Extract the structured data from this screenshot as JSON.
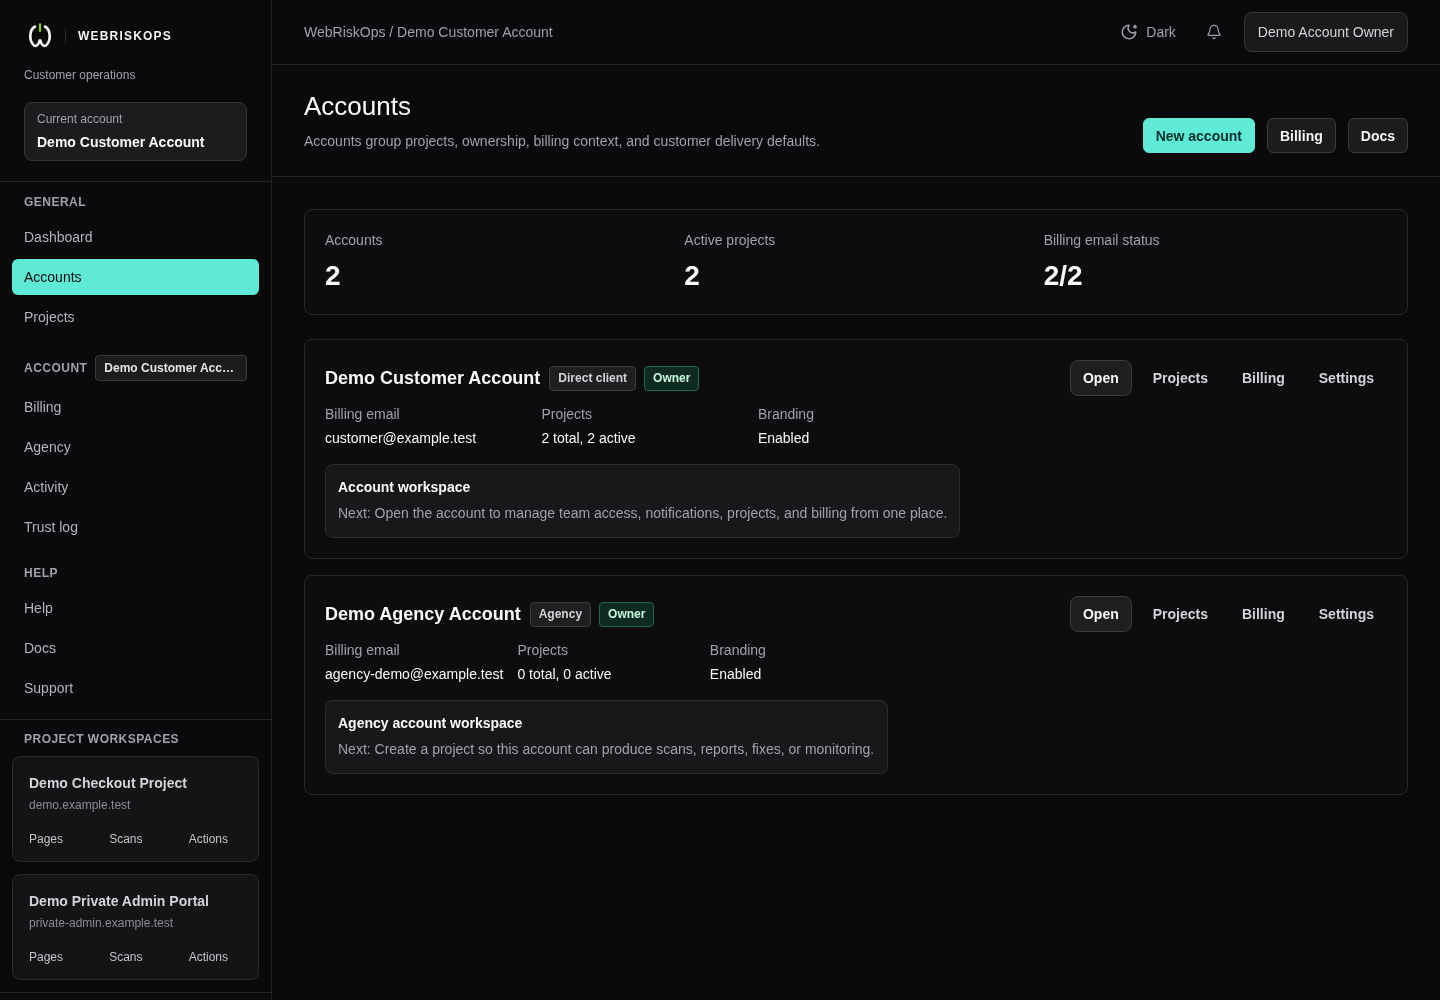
{
  "sidebar": {
    "brand": {
      "name": "WEBRISKOPS",
      "tagline": "Customer operations"
    },
    "current_account": {
      "label": "Current account",
      "name": "Demo Customer Account"
    },
    "sections": [
      {
        "title": "GENERAL",
        "items": [
          {
            "label": "Dashboard",
            "selected": false
          },
          {
            "label": "Accounts",
            "selected": true
          },
          {
            "label": "Projects",
            "selected": false
          }
        ]
      },
      {
        "title": "ACCOUNT",
        "chip": "Demo Customer Acc…",
        "items": [
          {
            "label": "Billing",
            "selected": false
          },
          {
            "label": "Agency",
            "selected": false
          },
          {
            "label": "Activity",
            "selected": false
          },
          {
            "label": "Trust log",
            "selected": false
          }
        ]
      },
      {
        "title": "HELP",
        "items": [
          {
            "label": "Help",
            "selected": false
          },
          {
            "label": "Docs",
            "selected": false
          },
          {
            "label": "Support",
            "selected": false
          }
        ]
      }
    ],
    "workspaces": {
      "title": "PROJECT WORKSPACES",
      "projects": [
        {
          "name": "Demo Checkout Project",
          "domain": "demo.example.test",
          "links": [
            "Pages",
            "Scans",
            "Actions"
          ]
        },
        {
          "name": "Demo Private Admin Portal",
          "domain": "private-admin.example.test",
          "links": [
            "Pages",
            "Scans",
            "Actions"
          ]
        }
      ]
    }
  },
  "topbar": {
    "breadcrumb": "WebRiskOps / Demo Customer Account",
    "theme": "Dark",
    "user_button": "Demo Account Owner"
  },
  "page_header": {
    "title": "Accounts",
    "subtitle": "Accounts group projects, ownership, billing context, and customer delivery defaults.",
    "actions": [
      {
        "label": "New account",
        "kind": "primary"
      },
      {
        "label": "Billing",
        "kind": "secondary"
      },
      {
        "label": "Docs",
        "kind": "secondary"
      }
    ]
  },
  "stats": [
    {
      "label": "Accounts",
      "value": "2"
    },
    {
      "label": "Active projects",
      "value": "2"
    },
    {
      "label": "Billing email status",
      "value": "2/2"
    }
  ],
  "accounts": [
    {
      "name": "Demo Customer Account",
      "badges": [
        {
          "label": "Direct client",
          "kind": "neutral"
        },
        {
          "label": "Owner",
          "kind": "success"
        }
      ],
      "actions": [
        {
          "label": "Open",
          "kind": "outlined"
        },
        {
          "label": "Projects",
          "kind": "plain"
        },
        {
          "label": "Billing",
          "kind": "plain"
        },
        {
          "label": "Settings",
          "kind": "plain"
        }
      ],
      "fields": [
        {
          "label": "Billing email",
          "value": "customer@example.test"
        },
        {
          "label": "Projects",
          "value": "2 total, 2 active"
        },
        {
          "label": "Branding",
          "value": "Enabled"
        }
      ],
      "workspace": {
        "title": "Account workspace",
        "text": "Next: Open the account to manage team access, notifications, projects, and billing from one place."
      }
    },
    {
      "name": "Demo Agency Account",
      "badges": [
        {
          "label": "Agency",
          "kind": "neutral"
        },
        {
          "label": "Owner",
          "kind": "success"
        }
      ],
      "actions": [
        {
          "label": "Open",
          "kind": "outlined"
        },
        {
          "label": "Projects",
          "kind": "plain"
        },
        {
          "label": "Billing",
          "kind": "plain"
        },
        {
          "label": "Settings",
          "kind": "plain"
        }
      ],
      "fields": [
        {
          "label": "Billing email",
          "value": "agency-demo@example.test"
        },
        {
          "label": "Projects",
          "value": "0 total, 0 active"
        },
        {
          "label": "Branding",
          "value": "Enabled"
        }
      ],
      "workspace": {
        "title": "Agency account workspace",
        "text": "Next: Create a project so this account can produce scans, reports, fixes, or monitoring."
      }
    }
  ]
}
